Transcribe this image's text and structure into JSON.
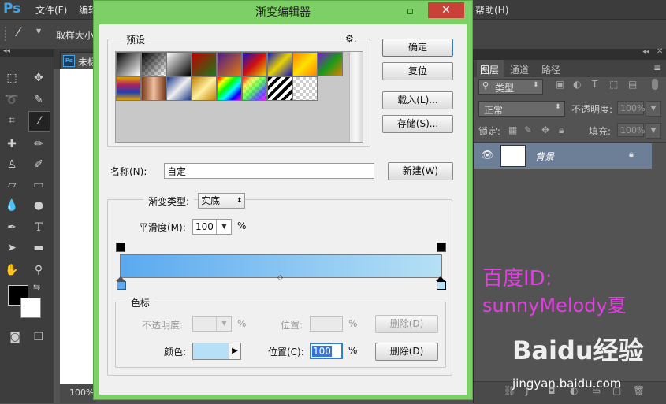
{
  "app": {
    "logo": "Ps"
  },
  "menubar": {
    "items": [
      "文件(F)",
      "编辑",
      "帮助(H)"
    ]
  },
  "options_bar": {
    "sample_size_label": "取样大小"
  },
  "document": {
    "tab_title": "未标",
    "zoom": "100%"
  },
  "dialog": {
    "title": "渐变编辑器",
    "close_glyph": "✕",
    "help_glyph": "▫",
    "presets": {
      "label": "预设",
      "gear": "⚙."
    },
    "buttons": {
      "ok": "确定",
      "reset": "复位",
      "load": "载入(L)...",
      "save": "存储(S)...",
      "new": "新建(W)"
    },
    "name": {
      "label": "名称(N):",
      "value": "自定"
    },
    "gradient_type": {
      "label": "渐变类型:",
      "value": "实底"
    },
    "smoothness": {
      "label": "平滑度(M):",
      "value": "100",
      "unit": "%"
    },
    "gradient": {
      "start_color": "#5aa9f0",
      "end_color": "#b6e0f5"
    },
    "color_stops": {
      "group_label": "色标",
      "opacity_label": "不透明度:",
      "opacity_unit": "%",
      "opacity_location_label": "位置:",
      "opacity_location_unit": "%",
      "opacity_delete": "删除(D)",
      "color_label": "颜色:",
      "color_swatch": "#b6e0f5",
      "color_location_label": "位置(C):",
      "color_location_value": "100",
      "color_location_unit": "%",
      "color_delete": "删除(D)"
    }
  },
  "layers_panel": {
    "tabs": [
      "图层",
      "通道",
      "路径"
    ],
    "filter": "类型",
    "blend_mode": "正常",
    "opacity_label": "不透明度:",
    "opacity_value": "100%",
    "lock_label": "锁定:",
    "fill_label": "填充:",
    "fill_value": "100%",
    "layer_name": "背景"
  },
  "watermark": {
    "line1": "百度ID:",
    "line2": "sunnyMelody夏",
    "brand": "Baidu经验",
    "url": "jingyan.baidu.com"
  }
}
